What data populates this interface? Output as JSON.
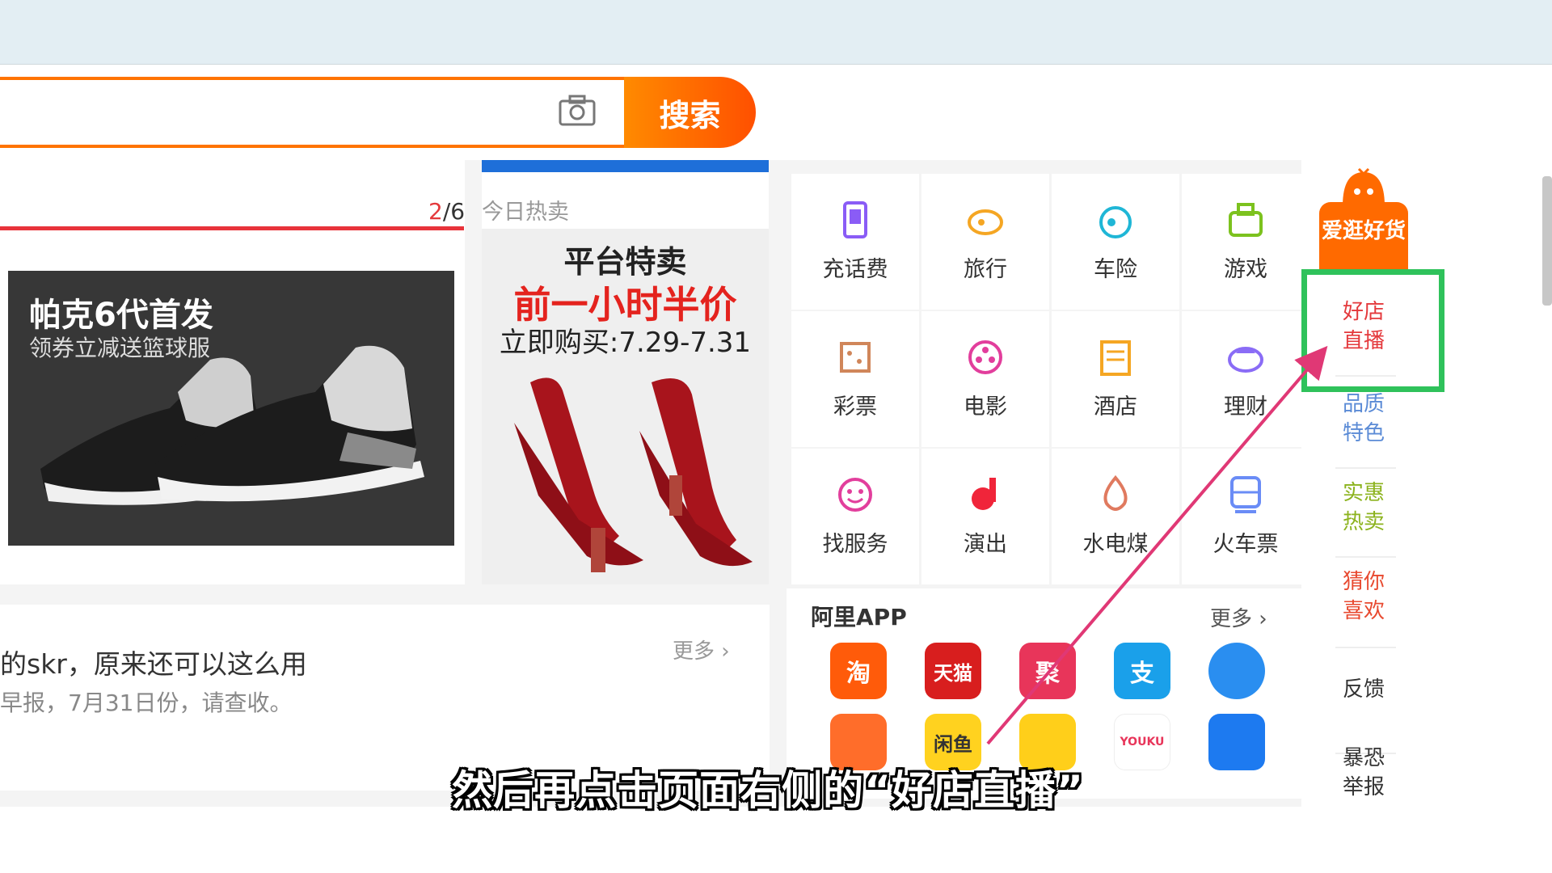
{
  "search": {
    "button_label": "搜索",
    "camera_icon": "camera-icon"
  },
  "carousel": {
    "current": "2",
    "total": "/6",
    "promo_title": "帕克6代首发",
    "promo_sub": "领券立减送篮球服"
  },
  "hot_sale": {
    "label": "今日热卖",
    "line1": "平台特卖",
    "line2": "前一小时半价",
    "line3": "立即购买:7.29-7.31"
  },
  "news": {
    "more": "更多 ›",
    "line1": "的skr，原来还可以这么用",
    "line2": "早报，7月31日份，请查收。"
  },
  "services": [
    {
      "label": "充话费",
      "icon": "phone-recharge-icon",
      "color": "#8a5cf6"
    },
    {
      "label": "旅行",
      "icon": "travel-icon",
      "color": "#f5a623"
    },
    {
      "label": "车险",
      "icon": "car-insurance-icon",
      "color": "#1fb6d6"
    },
    {
      "label": "游戏",
      "icon": "game-icon",
      "color": "#7cc21e"
    },
    {
      "label": "彩票",
      "icon": "lottery-icon",
      "color": "#d0865a"
    },
    {
      "label": "电影",
      "icon": "movie-icon",
      "color": "#e23e9c"
    },
    {
      "label": "酒店",
      "icon": "hotel-icon",
      "color": "#f5a623"
    },
    {
      "label": "理财",
      "icon": "finance-icon",
      "color": "#8a6cf6"
    },
    {
      "label": "找服务",
      "icon": "service-icon",
      "color": "#e23e9c"
    },
    {
      "label": "演出",
      "icon": "show-icon",
      "color": "#f0253a"
    },
    {
      "label": "水电煤",
      "icon": "utilities-icon",
      "color": "#e07a5f"
    },
    {
      "label": "火车票",
      "icon": "train-ticket-icon",
      "color": "#6a8cf6"
    }
  ],
  "ali_app": {
    "title": "阿里APP",
    "more": "更多 ›",
    "apps": [
      {
        "name": "taobao-app-icon",
        "text": "淘",
        "color": "#ff5b0a"
      },
      {
        "name": "tmall-app-icon",
        "text": "天猫",
        "color": "#d81e1e"
      },
      {
        "name": "juhuasuan-app-icon",
        "text": "聚",
        "color": "#e8355a"
      },
      {
        "name": "alipay-app-icon",
        "text": "支",
        "color": "#1aa0ea"
      },
      {
        "name": "dingtalk-bubble-app-icon",
        "text": "",
        "color": "#2a8ef0"
      },
      {
        "name": "smile-app-icon",
        "text": "",
        "color": "#ff6d2a"
      },
      {
        "name": "xianyu-app-icon",
        "text": "闲鱼",
        "color": "#ffd21f"
      },
      {
        "name": "fliggy-app-icon",
        "text": "",
        "color": "#ffcf1a"
      },
      {
        "name": "youku-app-icon",
        "text": "YOUKU",
        "color": "#ffffff"
      },
      {
        "name": "dingtalk-app-icon",
        "text": "",
        "color": "#1d7af0"
      }
    ]
  },
  "sidebar": {
    "head": "爱逛好货",
    "items": [
      {
        "label": "好店直播",
        "color": "#e4393c"
      },
      {
        "label": "品质特色",
        "color": "#5b8bd6"
      },
      {
        "label": "实惠热卖",
        "color": "#8cb31e"
      },
      {
        "label": "猜你喜欢",
        "color": "#e84a30"
      },
      {
        "label": "反馈",
        "color": "#333333"
      },
      {
        "label": "暴恐举报",
        "color": "#333333"
      }
    ]
  },
  "subtitle": "然后再点击页面右侧的“好店直播”"
}
